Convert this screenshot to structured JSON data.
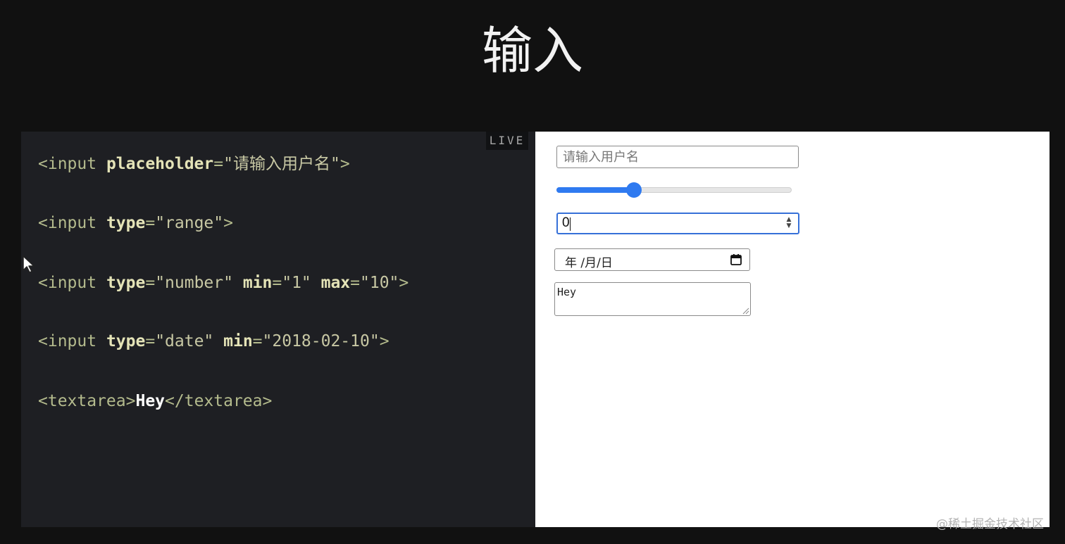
{
  "title": "输入",
  "live_label": "LIVE",
  "code": {
    "lines": [
      [
        {
          "t": "<input ",
          "c": "tag"
        },
        {
          "t": "placeholder",
          "c": "attr"
        },
        {
          "t": "=",
          "c": "tag"
        },
        {
          "t": "\"请输入用户名\"",
          "c": "str"
        },
        {
          "t": ">",
          "c": "tag"
        }
      ],
      [
        {
          "t": "<input ",
          "c": "tag"
        },
        {
          "t": "type",
          "c": "attr"
        },
        {
          "t": "=",
          "c": "tag"
        },
        {
          "t": "\"range\"",
          "c": "str"
        },
        {
          "t": ">",
          "c": "tag"
        }
      ],
      [
        {
          "t": "<input ",
          "c": "tag"
        },
        {
          "t": "type",
          "c": "attr"
        },
        {
          "t": "=",
          "c": "tag"
        },
        {
          "t": "\"number\" ",
          "c": "str"
        },
        {
          "t": "min",
          "c": "attr"
        },
        {
          "t": "=",
          "c": "tag"
        },
        {
          "t": "\"1\" ",
          "c": "str"
        },
        {
          "t": "max",
          "c": "attr"
        },
        {
          "t": "=",
          "c": "tag"
        },
        {
          "t": "\"10\"",
          "c": "str"
        },
        {
          "t": ">",
          "c": "tag"
        }
      ],
      [
        {
          "t": "<input ",
          "c": "tag"
        },
        {
          "t": "type",
          "c": "attr"
        },
        {
          "t": "=",
          "c": "tag"
        },
        {
          "t": "\"date\" ",
          "c": "str"
        },
        {
          "t": "min",
          "c": "attr"
        },
        {
          "t": "=",
          "c": "tag"
        },
        {
          "t": "\"2018-02-10\"",
          "c": "str"
        },
        {
          "t": ">",
          "c": "tag"
        }
      ],
      [
        {
          "t": "<textarea>",
          "c": "tag"
        },
        {
          "t": "Hey",
          "c": "text"
        },
        {
          "t": "</textarea>",
          "c": "tag"
        }
      ]
    ]
  },
  "preview": {
    "text_input": {
      "placeholder": "请输入用户名"
    },
    "range": {
      "value_fraction": 0.33
    },
    "number": {
      "value": "0"
    },
    "date": {
      "placeholder": "年 /月/日"
    },
    "textarea": {
      "value": "Hey"
    }
  },
  "colors": {
    "accent": "#2f7af0",
    "background": "#111111",
    "code_background": "#1e1f23"
  },
  "watermark": "@稀土掘金技术社区"
}
